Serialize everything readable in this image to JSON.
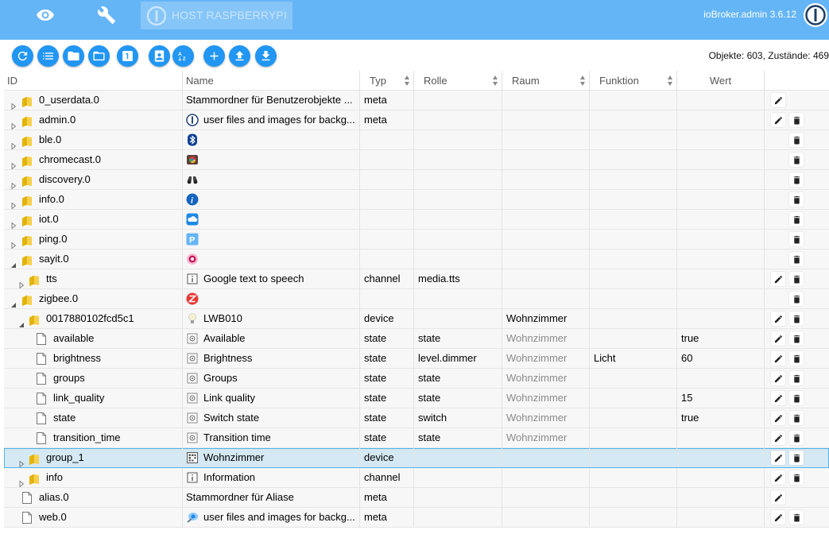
{
  "header": {
    "host_label": "HOST RASPBERRYPI",
    "app_title": "ioBroker.admin 3.6.12",
    "accent": "#64b5f6"
  },
  "toolbar": {
    "buttons": [
      "refresh-icon",
      "list-icon",
      "folder-closed-icon",
      "folder-open-icon",
      "number-one-icon",
      "contact-icon",
      "sort-az-icon",
      "add-icon",
      "upload-icon",
      "download-icon"
    ],
    "counts_text": "Objekte: 603, Zustände: 469"
  },
  "columns": {
    "id": "ID",
    "name": "Name",
    "typ": "Typ",
    "rolle": "Rolle",
    "raum": "Raum",
    "funktion": "Funktion",
    "wert": "Wert"
  },
  "rows": [
    {
      "id": "0_userdata.0",
      "name": "Stammordner für Benutzerobjekte ...",
      "typ": "meta",
      "rolle": "",
      "raum": "",
      "funktion": "",
      "wert": "",
      "icon": "",
      "depth": 0,
      "kind": "folder",
      "expander": "closed",
      "edit": true,
      "del": false
    },
    {
      "id": "admin.0",
      "name": "user files and images for backg...",
      "typ": "meta",
      "rolle": "",
      "raum": "",
      "funktion": "",
      "wert": "",
      "icon": "iobroker-icon",
      "depth": 0,
      "kind": "folder",
      "expander": "closed",
      "edit": true,
      "del": true
    },
    {
      "id": "ble.0",
      "name": "",
      "typ": "",
      "rolle": "",
      "raum": "",
      "funktion": "",
      "wert": "",
      "icon": "bluetooth-icon",
      "depth": 0,
      "kind": "folder",
      "expander": "closed",
      "edit": false,
      "del": true
    },
    {
      "id": "chromecast.0",
      "name": "",
      "typ": "",
      "rolle": "",
      "raum": "",
      "funktion": "",
      "wert": "",
      "icon": "chromecast-icon",
      "depth": 0,
      "kind": "folder",
      "expander": "closed",
      "edit": false,
      "del": true
    },
    {
      "id": "discovery.0",
      "name": "",
      "typ": "",
      "rolle": "",
      "raum": "",
      "funktion": "",
      "wert": "",
      "icon": "binoculars-icon",
      "depth": 0,
      "kind": "folder",
      "expander": "closed",
      "edit": false,
      "del": true
    },
    {
      "id": "info.0",
      "name": "",
      "typ": "",
      "rolle": "",
      "raum": "",
      "funktion": "",
      "wert": "",
      "icon": "info-icon",
      "depth": 0,
      "kind": "folder",
      "expander": "closed",
      "edit": false,
      "del": true
    },
    {
      "id": "iot.0",
      "name": "",
      "typ": "",
      "rolle": "",
      "raum": "",
      "funktion": "",
      "wert": "",
      "icon": "cloud-icon",
      "depth": 0,
      "kind": "folder",
      "expander": "closed",
      "edit": false,
      "del": true
    },
    {
      "id": "ping.0",
      "name": "",
      "typ": "",
      "rolle": "",
      "raum": "",
      "funktion": "",
      "wert": "",
      "icon": "ping-icon",
      "depth": 0,
      "kind": "folder",
      "expander": "closed",
      "edit": false,
      "del": true
    },
    {
      "id": "sayit.0",
      "name": "",
      "typ": "",
      "rolle": "",
      "raum": "",
      "funktion": "",
      "wert": "",
      "icon": "sayit-icon",
      "depth": 0,
      "kind": "folder",
      "expander": "open",
      "edit": false,
      "del": true
    },
    {
      "id": "tts",
      "name": "Google text to speech",
      "typ": "channel",
      "rolle": "media.tts",
      "raum": "",
      "funktion": "",
      "wert": "",
      "icon": "channel-icon",
      "depth": 1,
      "kind": "folder",
      "expander": "closed",
      "edit": true,
      "del": true
    },
    {
      "id": "zigbee.0",
      "name": "",
      "typ": "",
      "rolle": "",
      "raum": "",
      "funktion": "",
      "wert": "",
      "icon": "zigbee-icon",
      "depth": 0,
      "kind": "folder",
      "expander": "open",
      "edit": false,
      "del": true
    },
    {
      "id": "0017880102fcd5c1",
      "name": "LWB010",
      "typ": "device",
      "rolle": "",
      "raum": "Wohnzimmer",
      "funktion": "",
      "wert": "",
      "icon": "bulb-icon",
      "depth": 1,
      "kind": "folder",
      "expander": "open",
      "edit": true,
      "del": true
    },
    {
      "id": "available",
      "name": "Available",
      "typ": "state",
      "rolle": "state",
      "raum": "Wohnzimmer",
      "raumInherited": true,
      "funktion": "",
      "wert": "true",
      "icon": "state-icon",
      "depth": 2,
      "kind": "file",
      "expander": "",
      "edit": true,
      "del": true
    },
    {
      "id": "brightness",
      "name": "Brightness",
      "typ": "state",
      "rolle": "level.dimmer",
      "raum": "Wohnzimmer",
      "raumInherited": true,
      "funktion": "Licht",
      "wert": "60",
      "icon": "state-icon",
      "depth": 2,
      "kind": "file",
      "expander": "",
      "edit": true,
      "del": true
    },
    {
      "id": "groups",
      "name": "Groups",
      "typ": "state",
      "rolle": "state",
      "raum": "Wohnzimmer",
      "raumInherited": true,
      "funktion": "",
      "wert": "",
      "icon": "state-icon",
      "depth": 2,
      "kind": "file",
      "expander": "",
      "edit": true,
      "del": true
    },
    {
      "id": "link_quality",
      "name": "Link quality",
      "typ": "state",
      "rolle": "state",
      "raum": "Wohnzimmer",
      "raumInherited": true,
      "funktion": "",
      "wert": "15",
      "icon": "state-icon",
      "depth": 2,
      "kind": "file",
      "expander": "",
      "edit": true,
      "del": true
    },
    {
      "id": "state",
      "name": "Switch state",
      "typ": "state",
      "rolle": "switch",
      "raum": "Wohnzimmer",
      "raumInherited": true,
      "funktion": "",
      "wert": "true",
      "icon": "state-icon",
      "depth": 2,
      "kind": "file",
      "expander": "",
      "edit": true,
      "del": true
    },
    {
      "id": "transition_time",
      "name": "Transition time",
      "typ": "state",
      "rolle": "state",
      "raum": "Wohnzimmer",
      "raumInherited": true,
      "funktion": "",
      "wert": "",
      "icon": "state-icon",
      "depth": 2,
      "kind": "file",
      "expander": "",
      "edit": true,
      "del": true
    },
    {
      "id": "group_1",
      "name": "Wohnzimmer",
      "typ": "device",
      "rolle": "",
      "raum": "",
      "funktion": "",
      "wert": "",
      "icon": "group-icon",
      "depth": 1,
      "kind": "folder",
      "expander": "closed",
      "edit": true,
      "del": true,
      "selected": true
    },
    {
      "id": "info",
      "name": "Information",
      "typ": "channel",
      "rolle": "",
      "raum": "",
      "funktion": "",
      "wert": "",
      "icon": "channel-icon",
      "depth": 1,
      "kind": "folder",
      "expander": "closed",
      "edit": true,
      "del": true
    },
    {
      "id": "alias.0",
      "name": "Stammordner für Aliase",
      "typ": "meta",
      "rolle": "",
      "raum": "",
      "funktion": "",
      "wert": "",
      "icon": "",
      "depth": 0,
      "kind": "file",
      "expander": "",
      "edit": true,
      "del": false
    },
    {
      "id": "web.0",
      "name": "user files and images for backg...",
      "typ": "meta",
      "rolle": "",
      "raum": "",
      "funktion": "",
      "wert": "",
      "icon": "web-icon",
      "depth": 0,
      "kind": "file",
      "expander": "",
      "edit": true,
      "del": true
    }
  ]
}
